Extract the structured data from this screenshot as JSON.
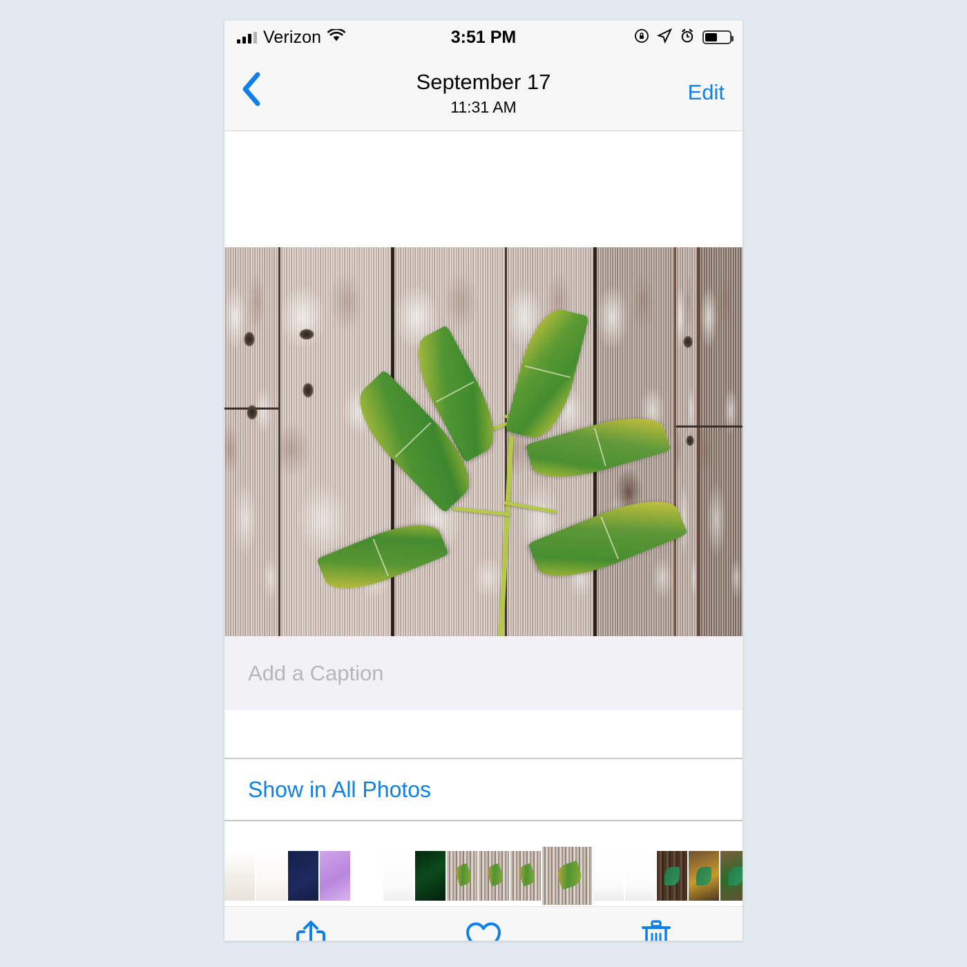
{
  "theme": {
    "page_bg": "#e2e9f0",
    "bar_bg": "#f7f7f7",
    "accent_blue": "#1080e8",
    "caption_bg": "#f2f1f6",
    "placeholder_gray": "#b6b6bb",
    "separator": "#c8c7cc"
  },
  "status_bar": {
    "carrier": "Verizon",
    "time": "3:51 PM",
    "signal_bars_filled": 3,
    "signal_bars_total": 4,
    "battery_percent": 45,
    "icons": [
      "signal-bars-icon",
      "wifi-icon",
      "rotation-lock-icon",
      "location-arrow-icon",
      "alarm-clock-icon",
      "battery-icon"
    ]
  },
  "nav_bar": {
    "back_icon": "chevron-left-icon",
    "title": "September 17",
    "subtitle": "11:31 AM",
    "edit_label": "Edit"
  },
  "photo": {
    "alt": "Green and yellow compound ash leaf lying on weathered white-painted wooden planks",
    "leaf_green": "#4f9434",
    "leaf_yellow": "#d8a93b",
    "wood_base": "#8a7a72"
  },
  "caption": {
    "placeholder": "Add a Caption",
    "value": ""
  },
  "actions": {
    "show_in_all_photos": "Show in All Photos"
  },
  "filmstrip": {
    "selected_index": 10,
    "thumbnails": [
      {
        "name": "thumb-pinterest-board",
        "kind": "pin"
      },
      {
        "name": "thumb-flamingo-card",
        "kind": "flamingo"
      },
      {
        "name": "thumb-worth-living-for-navy",
        "kind": "navy-text"
      },
      {
        "name": "thumb-worth-living-for-purple",
        "kind": "purple-text"
      },
      {
        "name": "thumb-your-photo-white",
        "kind": "white-text"
      },
      {
        "name": "thumb-app-list-screenshot",
        "kind": "applist"
      },
      {
        "name": "thumb-la-jolla-neon",
        "kind": "neon"
      },
      {
        "name": "thumb-leaf-wood-a",
        "kind": "leafwood"
      },
      {
        "name": "thumb-leaf-wood-b",
        "kind": "leafwood"
      },
      {
        "name": "thumb-leaf-wood-c",
        "kind": "leafwood"
      },
      {
        "name": "thumb-leaf-wood-selected",
        "kind": "leafwood"
      },
      {
        "name": "thumb-instagram-feed-a",
        "kind": "instagram"
      },
      {
        "name": "thumb-instagram-feed-b",
        "kind": "instagram"
      },
      {
        "name": "thumb-fall-dear-dark-wood",
        "kind": "falldark"
      },
      {
        "name": "thumb-fall-dear-yellow-leaf",
        "kind": "fallyellow"
      },
      {
        "name": "thumb-fall-dear-green-moss",
        "kind": "fallgreen"
      },
      {
        "name": "thumb-fall-dear-birch",
        "kind": "fallbirch"
      },
      {
        "name": "thumb-fall-dear-gold-leaf",
        "kind": "fallgold"
      },
      {
        "name": "thumb-fall-dear-curl",
        "kind": "fallcurl"
      },
      {
        "name": "thumb-fall-dear-acorns",
        "kind": "fallacorn"
      }
    ]
  },
  "toolbar": {
    "share_label": "Share",
    "favorite_label": "Favorite",
    "delete_label": "Delete",
    "icons": [
      "share-icon",
      "heart-icon",
      "trash-icon"
    ]
  }
}
